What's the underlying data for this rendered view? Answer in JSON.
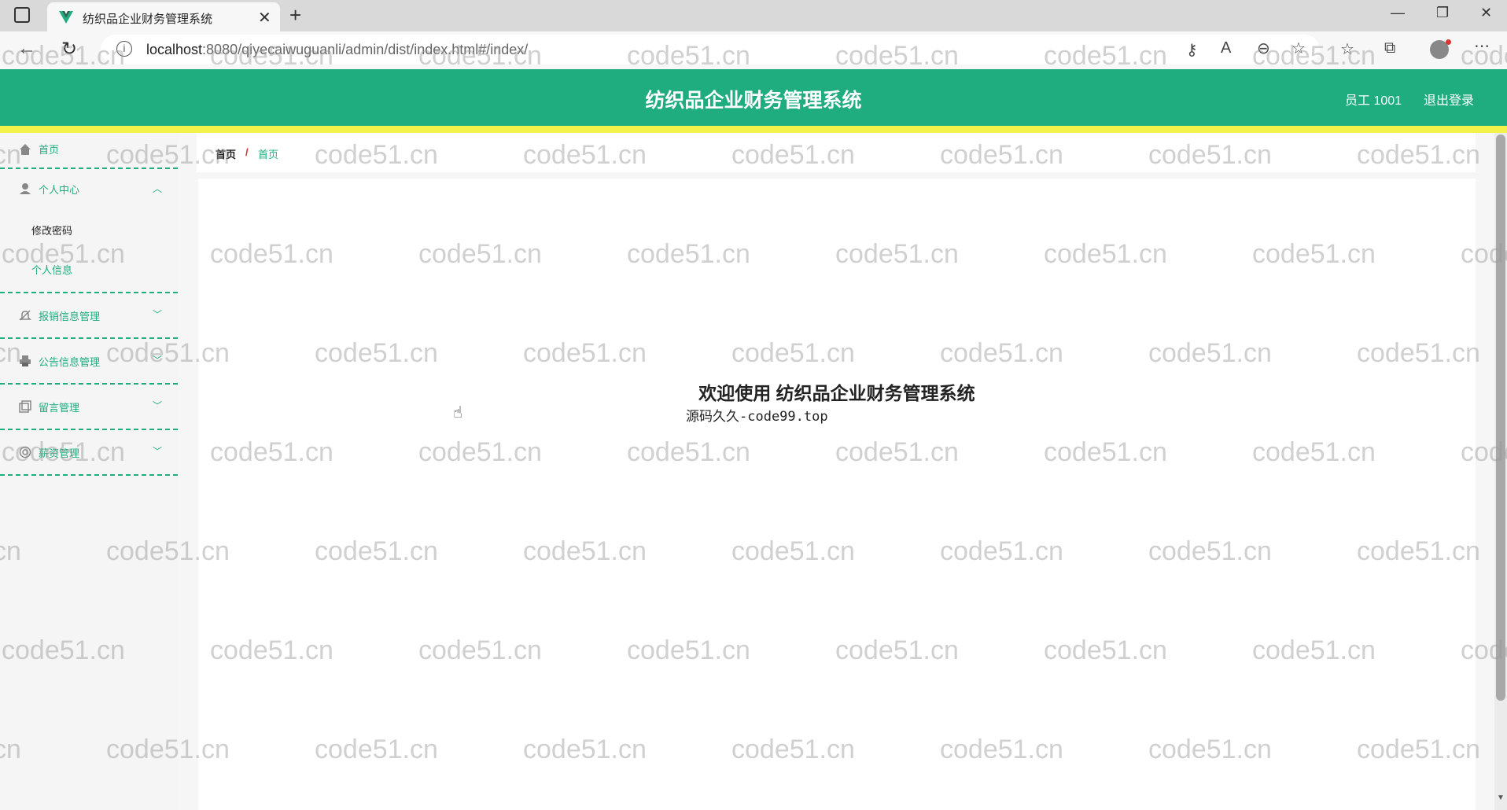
{
  "browser": {
    "tab_title": "纺织品企业财务管理系统",
    "url_host": "localhost",
    "url_path": ":8080/qiyecaiwuguanli/admin/dist/index.html#/index/"
  },
  "header": {
    "title": "纺织品企业财务管理系统",
    "user": "员工 1001",
    "logout": "退出登录"
  },
  "sidebar": {
    "home": "首页",
    "personal_center": {
      "label": "个人中心",
      "children": [
        "修改密码",
        "个人信息"
      ]
    },
    "menus": [
      "报销信息管理",
      "公告信息管理",
      "留言管理",
      "薪资管理"
    ]
  },
  "breadcrumb": {
    "root": "首页",
    "separator": "/",
    "current": "首页"
  },
  "main": {
    "welcome": "欢迎使用 纺织品企业财务管理系统",
    "source": "源码久久-code99.top"
  },
  "watermark": "code51.cn",
  "colors": {
    "accent": "#1fac7e",
    "stripe": "#f2f24a"
  }
}
